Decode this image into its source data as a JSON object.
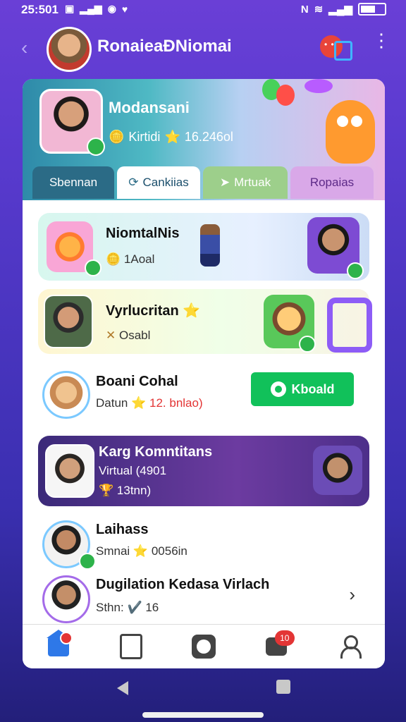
{
  "status": {
    "time": "25:501",
    "left_icons": [
      "notification-icon",
      "signal-icon",
      "circle-icon",
      "heart-icon"
    ],
    "right_icons": [
      "n-icon",
      "wifi-icon",
      "signal-icon",
      "battery-icon"
    ]
  },
  "app_bar": {
    "title": "RonaieaÐNiomai",
    "back_icon": "chevron-left-icon",
    "chat_icon": "chat-icon",
    "more_icon": "more-vertical-icon"
  },
  "hero": {
    "name": "Modansani",
    "stat_label": "Kirtidi",
    "stat_value": "16.246ol",
    "coin_glyph": "🪙",
    "star_glyph": "⭐"
  },
  "tabs": [
    {
      "label": "Sbennan"
    },
    {
      "label": "Cankiias"
    },
    {
      "label": "Mrtuak"
    },
    {
      "label": "Ropaias"
    }
  ],
  "items": [
    {
      "title": "NiomtalNis",
      "sub": "1Aoal",
      "glyph": "🪙"
    },
    {
      "title": "Vyrlucritan",
      "sub": "Osabl",
      "glyph": "✕",
      "star": "⭐"
    },
    {
      "title": "Boani Cohal",
      "sub": "Datun",
      "value": "12. bnlao)",
      "star": "⭐",
      "button": "Kboald"
    },
    {
      "title": "Karg Komntitans",
      "line2": "Virtual (4901",
      "sub": "13tnn)",
      "glyph": "🏆"
    },
    {
      "title": "Laihass",
      "sub": "Smnai",
      "value": "0056in",
      "star": "⭐"
    },
    {
      "title": "Dugilation Kedasa Virlach",
      "sub": "Sthn:",
      "value": "16",
      "glyph": "✔️"
    }
  ],
  "bottom_nav": {
    "home_icon": "home-icon",
    "book_icon": "book-icon",
    "camera_icon": "camera-icon",
    "messages_icon": "message-icon",
    "messages_badge": "10",
    "profile_icon": "person-icon"
  },
  "colors": {
    "accent_green": "#11c15a",
    "accent_blue": "#2e78e8",
    "badge_red": "#e33535",
    "purple_bg": "#6a3fd6"
  }
}
